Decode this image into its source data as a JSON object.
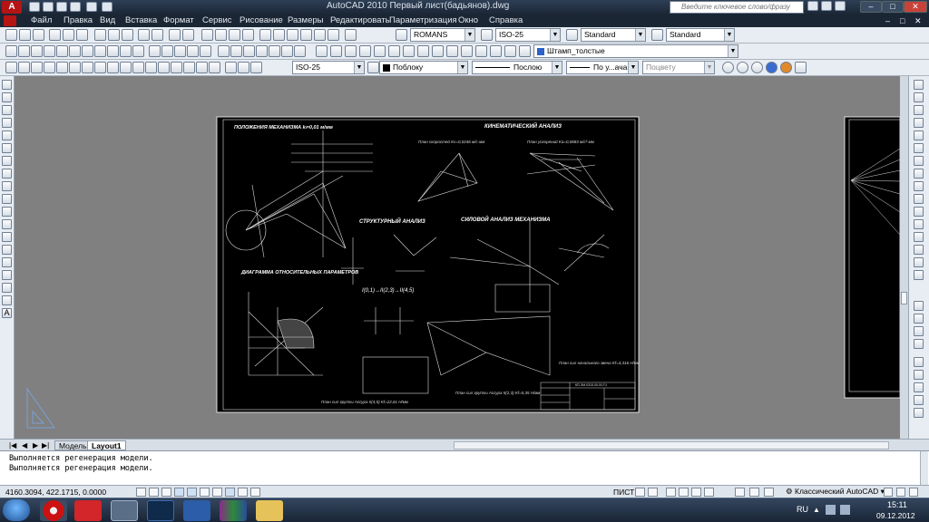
{
  "window": {
    "title": "AutoCAD 2010    Первый лист(бадьянов).dwg",
    "search_placeholder": "Введите ключевое слово/фразу",
    "accent": "#cc1111"
  },
  "menu": [
    "Файл",
    "Правка",
    "Вид",
    "Вставка",
    "Формат",
    "Сервис",
    "Рисование",
    "Размеры",
    "Редактировать",
    "Параметризация",
    "Окно",
    "Справка"
  ],
  "toolbar2": {
    "text_style": "ROMANS",
    "dim_style": "ISO-25",
    "table_style": "Standard",
    "mleader_style": "Standard"
  },
  "toolbar3": {
    "layer": "Штамп_толстые"
  },
  "toolbar4": {
    "dim_style": "ISO-25",
    "color": "Поблоку",
    "linetype": "Послою",
    "lineweight": "По у...ачанию",
    "plot_style": "Поцвету"
  },
  "drawing": {
    "sheet_title_left": "ПОЛОЖЕНИЯ МЕХАНИЗМА kₗ=0,01 м/мм",
    "kin_title": "КИНЕМАТИЧЕСКИЙ АНАЛИЗ",
    "velocity_plan": "План скоростей Kv=0,0246 м/с·мм",
    "accel_plan": "План ускорений Ka=0,0683 м/с²·мм",
    "struct_title": "СТРУКТУРНЫЙ АНАЛИЗ",
    "force_title": "СИЛОВОЙ АНАЛИЗ МЕХАНИЗМА",
    "diagram_title": "ДИАГРАММА ОТНОСИТЕЛЬНЫХ ПАРАМЕТРОВ",
    "formula": "I(0,1)→II(2,3)→II(4,5)",
    "force_plan_1": "План сил группы Ассура II(4,5) Kf=22,61 Н/мм",
    "force_plan_2": "План сил группы Ассура II(2,3) Kf=5,35 Н/мм",
    "force_plan_3": "План сил начального звена Kf=4,316 Н/мм",
    "drawing_number": "КП-ЭМ.0315.00.00.ГЧ"
  },
  "layout_tabs": {
    "model": "Модель",
    "layout1": "Layout1"
  },
  "command_lines": [
    "Выполняется регенерация модели.",
    "Выполняется регенерация модели."
  ],
  "status": {
    "coords": "4160.3094, 422.1715, 0.0000",
    "space": "ПИСТ",
    "workspace": "Классический AutoCAD"
  },
  "taskbar": {
    "lang": "RU",
    "time": "15:11",
    "date": "09.12.2012"
  }
}
